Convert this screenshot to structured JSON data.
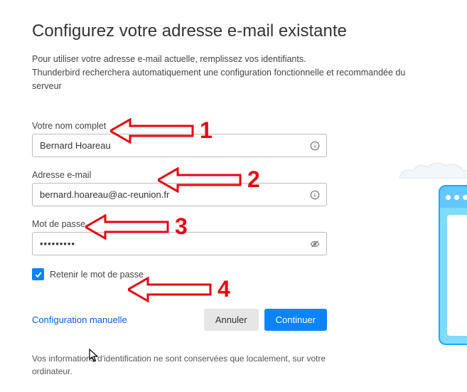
{
  "title": "Configurez votre adresse e-mail existante",
  "intro_line1": "Pour utiliser votre adresse e-mail actuelle, remplissez vos identifiants.",
  "intro_line2": "Thunderbird recherchera automatiquement une configuration fonctionnelle et recommandée du serveur",
  "fields": {
    "name": {
      "label": "Votre nom complet",
      "value": "Bernard Hoareau"
    },
    "email": {
      "label": "Adresse e-mail",
      "value": "bernard.hoareau@ac-reunion.fr"
    },
    "password": {
      "label": "Mot de passe",
      "value": "•••••••••"
    }
  },
  "remember": {
    "label": "Retenir le mot de passe",
    "checked": true
  },
  "manual_link": "Configuration manuelle",
  "buttons": {
    "cancel": "Annuler",
    "continue": "Continuer"
  },
  "footer": "Vos informations d'identification ne sont conservées que localement, sur votre ordinateur.",
  "annotations": {
    "a1": "1",
    "a2": "2",
    "a3": "3",
    "a4": "4"
  }
}
